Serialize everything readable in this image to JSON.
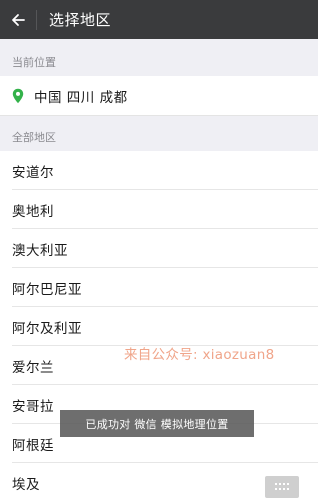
{
  "header": {
    "title": "选择地区"
  },
  "sections": {
    "current_label": "当前位置",
    "all_label": "全部地区"
  },
  "current_location": {
    "text": "中国 四川 成都"
  },
  "regions": [
    "安道尔",
    "奥地利",
    "澳大利亚",
    "阿尔巴尼亚",
    "阿尔及利亚",
    "爱尔兰",
    "安哥拉",
    "阿根廷",
    "埃及"
  ],
  "watermark": {
    "text": "来自公众号: xiaozuan8"
  },
  "toast": {
    "text": "已成功对 微信 模拟地理位置"
  },
  "colors": {
    "topbar": "#3a3b3d",
    "section_bg": "#efeff4",
    "pin": "#33b24a",
    "watermark": "#f0a58a"
  },
  "icons": {
    "back": "back-arrow-icon",
    "pin": "location-pin-icon",
    "keypad": "keypad-grid-icon"
  }
}
